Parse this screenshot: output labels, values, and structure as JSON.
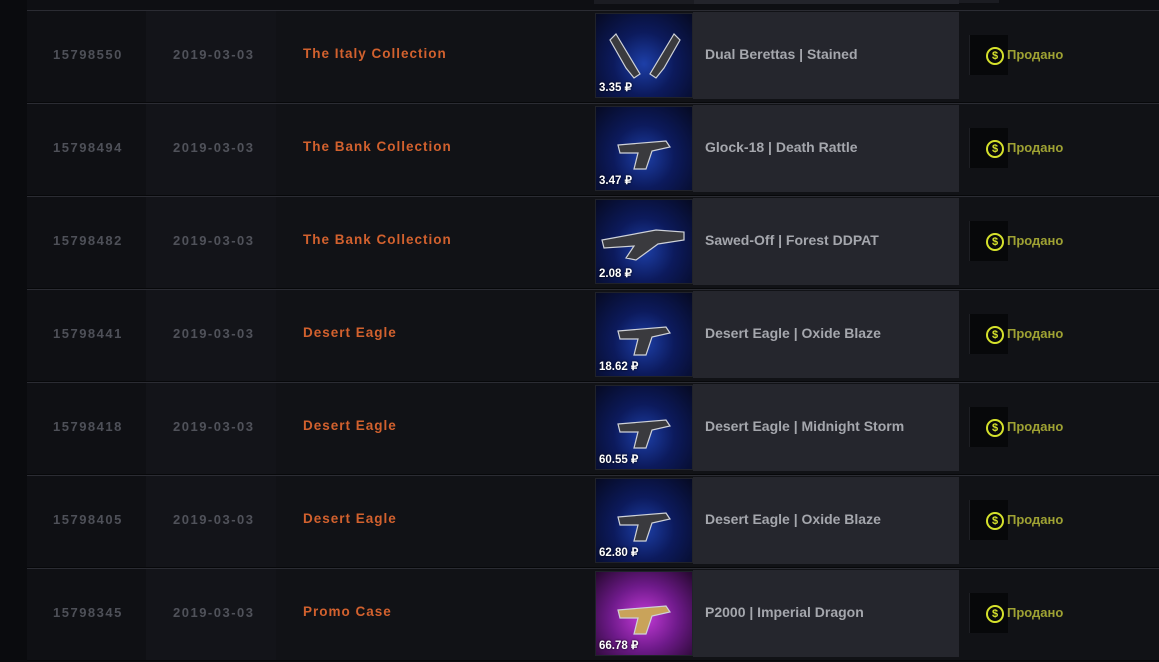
{
  "rows": [
    {
      "id": "15798550",
      "date": "2019-03-03",
      "case": "The Italy Collection",
      "item": "Dual Berettas | Stained",
      "price": "3.35 ₽",
      "status": "Продано",
      "icon": "dual-pistols-icon",
      "bg": "blue"
    },
    {
      "id": "15798494",
      "date": "2019-03-03",
      "case": "The Bank Collection",
      "item": "Glock-18 | Death Rattle",
      "price": "3.47 ₽",
      "status": "Продано",
      "icon": "pistol-icon",
      "bg": "blue"
    },
    {
      "id": "15798482",
      "date": "2019-03-03",
      "case": "The Bank Collection",
      "item": "Sawed-Off | Forest DDPAT",
      "price": "2.08 ₽",
      "status": "Продано",
      "icon": "shotgun-icon",
      "bg": "blue"
    },
    {
      "id": "15798441",
      "date": "2019-03-03",
      "case": "Desert Eagle",
      "item": "Desert Eagle | Oxide Blaze",
      "price": "18.62 ₽",
      "status": "Продано",
      "icon": "pistol-icon",
      "bg": "blue"
    },
    {
      "id": "15798418",
      "date": "2019-03-03",
      "case": "Desert Eagle",
      "item": "Desert Eagle | Midnight Storm",
      "price": "60.55 ₽",
      "status": "Продано",
      "icon": "pistol-icon",
      "bg": "blue"
    },
    {
      "id": "15798405",
      "date": "2019-03-03",
      "case": "Desert Eagle",
      "item": "Desert Eagle | Oxide Blaze",
      "price": "62.80 ₽",
      "status": "Продано",
      "icon": "pistol-icon",
      "bg": "blue"
    },
    {
      "id": "15798345",
      "date": "2019-03-03",
      "case": "Promo Case",
      "item": "P2000 | Imperial Dragon",
      "price": "66.78 ₽",
      "status": "Продано",
      "icon": "pistol-icon",
      "bg": "purple"
    }
  ],
  "colors": {
    "accent_case": "#d2612e",
    "status_text": "#9fa233",
    "coin": "#d6e22c",
    "thumb_blue": "#1d3fa8",
    "thumb_purple": "#c43ad8"
  },
  "icons": {
    "coin": "coin-icon"
  }
}
